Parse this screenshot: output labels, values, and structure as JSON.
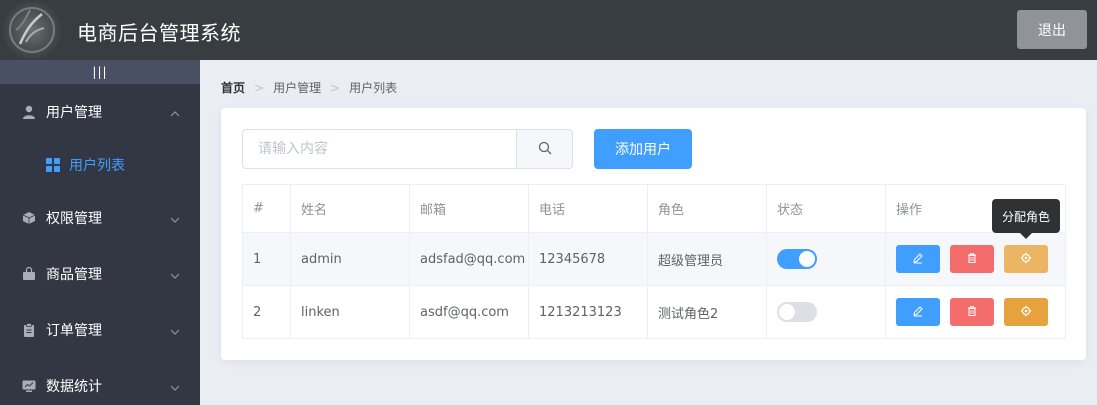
{
  "header": {
    "title": "电商后台管理系统",
    "logout_label": "退出",
    "background": "#373d41"
  },
  "sidebar": {
    "toggle_label": "|||",
    "items": [
      {
        "label": "用户管理",
        "icon": "user-icon",
        "expanded": true,
        "children": [
          {
            "label": "用户列表",
            "icon": "grid-icon",
            "active": true
          }
        ]
      },
      {
        "label": "权限管理",
        "icon": "cube-icon",
        "expanded": false
      },
      {
        "label": "商品管理",
        "icon": "bag-icon",
        "expanded": false
      },
      {
        "label": "订单管理",
        "icon": "clipboard-icon",
        "expanded": false
      },
      {
        "label": "数据统计",
        "icon": "chart-monitor-icon",
        "expanded": false
      }
    ]
  },
  "breadcrumb": {
    "items": [
      "首页",
      "用户管理",
      "用户列表"
    ]
  },
  "search": {
    "placeholder": "请输入内容",
    "value": ""
  },
  "add_button_label": "添加用户",
  "table": {
    "columns": [
      "#",
      "姓名",
      "邮箱",
      "电话",
      "角色",
      "状态",
      "操作"
    ],
    "rows": [
      {
        "index": "1",
        "name": "admin",
        "email": "adsfad@qq.com",
        "phone": "12345678",
        "role": "超级管理员",
        "status": true
      },
      {
        "index": "2",
        "name": "linken",
        "email": "asdf@qq.com",
        "phone": "1213213123",
        "role": "测试角色2",
        "status": false
      }
    ]
  },
  "tooltip": "分配角色",
  "colors": {
    "primary": "#409eff",
    "danger": "#f56c6c",
    "warning": "#e6a23c",
    "sidebar_bg": "#333744",
    "info": "#909399"
  }
}
